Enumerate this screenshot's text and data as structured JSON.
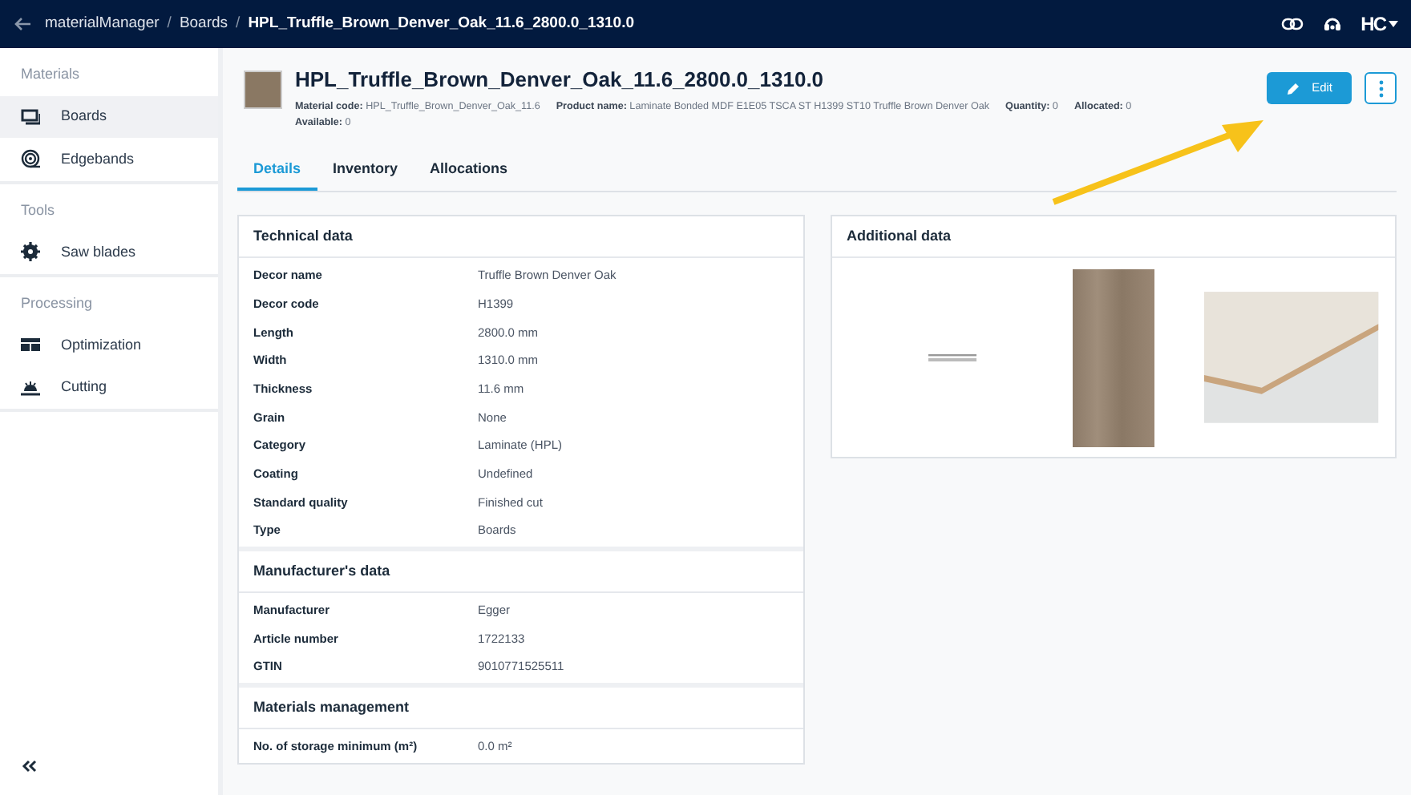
{
  "header": {
    "breadcrumbs": [
      {
        "label": "materialManager"
      },
      {
        "label": "Boards"
      },
      {
        "label": "HPL_Truffle_Brown_Denver_Oak_11.6_2800.0_1310.0"
      }
    ],
    "separator": "/",
    "user_menu": "HC"
  },
  "sidebar": {
    "groups": [
      {
        "title": "Materials",
        "items": [
          {
            "label": "Boards",
            "selected": true
          },
          {
            "label": "Edgebands",
            "selected": false
          }
        ]
      },
      {
        "title": "Tools",
        "items": [
          {
            "label": "Saw blades",
            "selected": false
          }
        ]
      },
      {
        "title": "Processing",
        "items": [
          {
            "label": "Optimization",
            "selected": false
          },
          {
            "label": "Cutting",
            "selected": false
          }
        ]
      }
    ]
  },
  "material": {
    "title": "HPL_Truffle_Brown_Denver_Oak_11.6_2800.0_1310.0",
    "meta": [
      {
        "label": "Material code:",
        "value": "HPL_Truffle_Brown_Denver_Oak_11.6"
      },
      {
        "label": "Product name:",
        "value": "Laminate Bonded MDF E1E05 TSCA ST H1399 ST10 Truffle Brown Denver Oak"
      },
      {
        "label": "Quantity:",
        "value": "0"
      },
      {
        "label": "Allocated:",
        "value": "0"
      },
      {
        "label": "Available:",
        "value": "0"
      }
    ],
    "edit_button": "Edit"
  },
  "tabs": [
    {
      "label": "Details",
      "selected": true
    },
    {
      "label": "Inventory",
      "selected": false
    },
    {
      "label": "Allocations",
      "selected": false
    }
  ],
  "details_card": {
    "sections": [
      {
        "title": "Technical data",
        "rows": [
          {
            "label": "Decor name",
            "value": "Truffle Brown Denver Oak"
          },
          {
            "label": "Decor code",
            "value": "H1399"
          },
          {
            "label": "Length",
            "value": "2800.0 mm"
          },
          {
            "label": "Width",
            "value": "1310.0 mm"
          },
          {
            "label": "Thickness",
            "value": "11.6 mm"
          },
          {
            "label": "Grain",
            "value": "None"
          },
          {
            "label": "Category",
            "value": "Laminate (HPL)"
          },
          {
            "label": "Coating",
            "value": "Undefined"
          },
          {
            "label": "Standard quality",
            "value": "Finished cut"
          },
          {
            "label": "Type",
            "value": "Boards"
          }
        ]
      },
      {
        "title": "Manufacturer's data",
        "rows": [
          {
            "label": "Manufacturer",
            "value": "Egger"
          },
          {
            "label": "Article number",
            "value": "1722133"
          },
          {
            "label": "GTIN",
            "value": "9010771525511"
          }
        ]
      },
      {
        "title": "Materials management",
        "rows": [
          {
            "label": "No. of storage minimum (m²)",
            "value": "0.0 m²"
          }
        ]
      }
    ]
  },
  "additional_card": {
    "title": "Additional data"
  }
}
